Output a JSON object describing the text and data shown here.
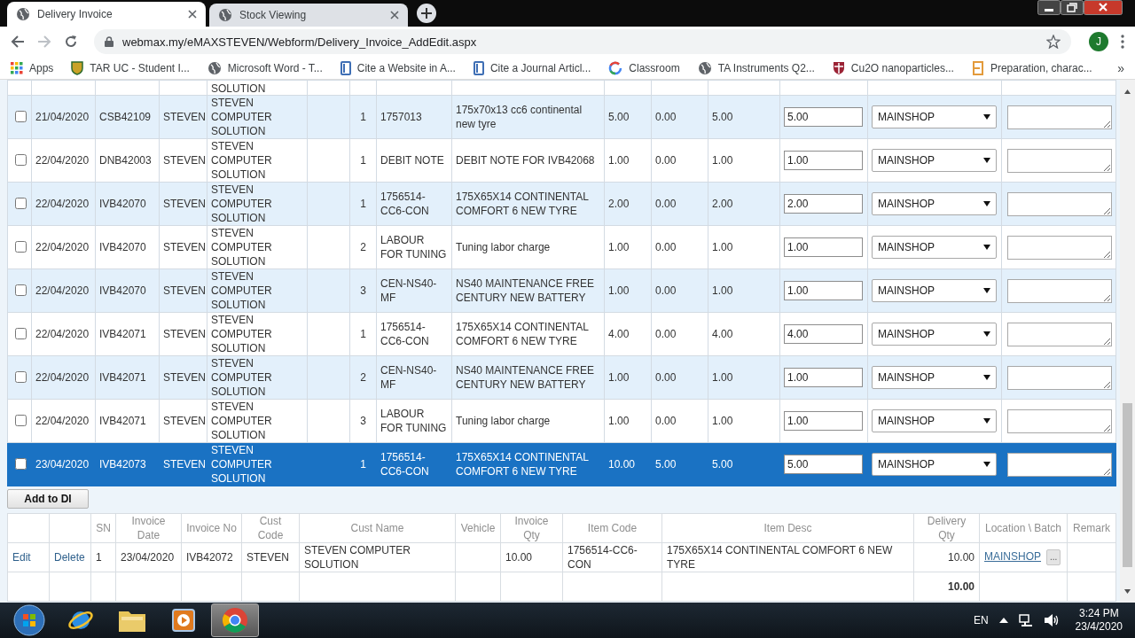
{
  "browser": {
    "tabs": [
      {
        "title": "Delivery Invoice",
        "selected": true
      },
      {
        "title": "Stock Viewing",
        "selected": false
      }
    ],
    "url": "webmax.my/eMAXSTEVEN/Webform/Delivery_Invoice_AddEdit.aspx",
    "profile_initial": "J",
    "bookmarks": [
      {
        "label": "Apps",
        "kind": "apps"
      },
      {
        "label": "TAR UC - Student I...",
        "kind": "shield"
      },
      {
        "label": "Microsoft Word - T...",
        "kind": "globe"
      },
      {
        "label": "Cite a Website in A...",
        "kind": "book"
      },
      {
        "label": "Cite a Journal Articl...",
        "kind": "book"
      },
      {
        "label": "Classroom",
        "kind": "ring"
      },
      {
        "label": "TA Instruments Q2...",
        "kind": "globe"
      },
      {
        "label": "Cu2O nanoparticles...",
        "kind": "crest"
      },
      {
        "label": "Preparation, charac...",
        "kind": "square"
      }
    ],
    "bookmarks_overflow": "»"
  },
  "invoice_grid": {
    "cut_row": {
      "cust_name": "SOLUTION"
    },
    "rows": [
      {
        "checked": false,
        "selected": false,
        "date": "21/04/2020",
        "doc_no": "CSB42109",
        "cust_code": "STEVEN",
        "cust_name": "STEVEN COMPUTER SOLUTION",
        "sn": "1",
        "item_code": "1757013",
        "item_desc": "175x70x13 cc6 continental new tyre",
        "column_10": "5.00",
        "column_11": "0.00",
        "column_12": "5.00",
        "qty_value": "5.00",
        "location": "MAINSHOP"
      },
      {
        "checked": false,
        "selected": false,
        "date": "22/04/2020",
        "doc_no": "DNB42003",
        "cust_code": "STEVEN",
        "cust_name": "STEVEN COMPUTER SOLUTION",
        "sn": "1",
        "item_code": "DEBIT NOTE",
        "item_desc": "DEBIT NOTE FOR IVB42068",
        "column_10": "1.00",
        "column_11": "0.00",
        "column_12": "1.00",
        "qty_value": "1.00",
        "location": "MAINSHOP"
      },
      {
        "checked": false,
        "selected": false,
        "date": "22/04/2020",
        "doc_no": "IVB42070",
        "cust_code": "STEVEN",
        "cust_name": "STEVEN COMPUTER SOLUTION",
        "sn": "1",
        "item_code": "1756514-CC6-CON",
        "item_desc": "175X65X14 CONTINENTAL COMFORT 6 NEW TYRE",
        "column_10": "2.00",
        "column_11": "0.00",
        "column_12": "2.00",
        "qty_value": "2.00",
        "location": "MAINSHOP"
      },
      {
        "checked": false,
        "selected": false,
        "date": "22/04/2020",
        "doc_no": "IVB42070",
        "cust_code": "STEVEN",
        "cust_name": "STEVEN COMPUTER SOLUTION",
        "sn": "2",
        "item_code": "LABOUR FOR TUNING",
        "item_desc": "Tuning labor charge",
        "column_10": "1.00",
        "column_11": "0.00",
        "column_12": "1.00",
        "qty_value": "1.00",
        "location": "MAINSHOP"
      },
      {
        "checked": false,
        "selected": false,
        "date": "22/04/2020",
        "doc_no": "IVB42070",
        "cust_code": "STEVEN",
        "cust_name": "STEVEN COMPUTER SOLUTION",
        "sn": "3",
        "item_code": "CEN-NS40-MF",
        "item_desc": "NS40 MAINTENANCE FREE CENTURY NEW BATTERY",
        "column_10": "1.00",
        "column_11": "0.00",
        "column_12": "1.00",
        "qty_value": "1.00",
        "location": "MAINSHOP"
      },
      {
        "checked": false,
        "selected": false,
        "date": "22/04/2020",
        "doc_no": "IVB42071",
        "cust_code": "STEVEN",
        "cust_name": "STEVEN COMPUTER SOLUTION",
        "sn": "1",
        "item_code": "1756514-CC6-CON",
        "item_desc": "175X65X14 CONTINENTAL COMFORT 6 NEW TYRE",
        "column_10": "4.00",
        "column_11": "0.00",
        "column_12": "4.00",
        "qty_value": "4.00",
        "location": "MAINSHOP"
      },
      {
        "checked": false,
        "selected": false,
        "date": "22/04/2020",
        "doc_no": "IVB42071",
        "cust_code": "STEVEN",
        "cust_name": "STEVEN COMPUTER SOLUTION",
        "sn": "2",
        "item_code": "CEN-NS40-MF",
        "item_desc": "NS40 MAINTENANCE FREE CENTURY NEW BATTERY",
        "column_10": "1.00",
        "column_11": "0.00",
        "column_12": "1.00",
        "qty_value": "1.00",
        "location": "MAINSHOP"
      },
      {
        "checked": false,
        "selected": false,
        "date": "22/04/2020",
        "doc_no": "IVB42071",
        "cust_code": "STEVEN",
        "cust_name": "STEVEN COMPUTER SOLUTION",
        "sn": "3",
        "item_code": "LABOUR FOR TUNING",
        "item_desc": "Tuning labor charge",
        "column_10": "1.00",
        "column_11": "0.00",
        "column_12": "1.00",
        "qty_value": "1.00",
        "location": "MAINSHOP"
      },
      {
        "checked": false,
        "selected": true,
        "date": "23/04/2020",
        "doc_no": "IVB42073",
        "cust_code": "STEVEN",
        "cust_name": "STEVEN COMPUTER SOLUTION",
        "sn": "1",
        "item_code": "1756514-CC6-CON",
        "item_desc": "175X65X14 CONTINENTAL COMFORT 6 NEW TYRE",
        "column_10": "10.00",
        "column_11": "5.00",
        "column_12": "5.00",
        "qty_value": "5.00",
        "location": "MAINSHOP"
      }
    ]
  },
  "add_button": "Add to DI",
  "di_table": {
    "columns": [
      "SN",
      "Invoice Date",
      "Invoice No",
      "Cust Code",
      "Cust Name",
      "Vehicle",
      "Invoice Qty",
      "Item Code",
      "Item Desc",
      "Delivery Qty",
      "Location \\ Batch",
      "Remark"
    ],
    "rows": [
      {
        "edit": "Edit",
        "delete": "Delete",
        "sn": "1",
        "invoice_date": "23/04/2020",
        "invoice_no": "IVB42072",
        "cust_code": "STEVEN",
        "cust_name": "STEVEN COMPUTER SOLUTION",
        "invoice_qty": "10.00",
        "item_code": "1756514-CC6-CON",
        "item_desc": "175X65X14 CONTINENTAL COMFORT 6 NEW TYRE",
        "delivery_qty": "10.00",
        "location": "MAINSHOP",
        "batch_button": "..."
      }
    ],
    "total": "10.00"
  },
  "taskbar": {
    "apps": [
      {
        "kind": "start",
        "selected": false
      },
      {
        "kind": "ie",
        "selected": false
      },
      {
        "kind": "folder",
        "selected": false
      },
      {
        "kind": "media",
        "selected": false
      },
      {
        "kind": "chrome",
        "selected": true
      }
    ],
    "language": "EN",
    "time": "3:24 PM",
    "date": "23/4/2020"
  }
}
